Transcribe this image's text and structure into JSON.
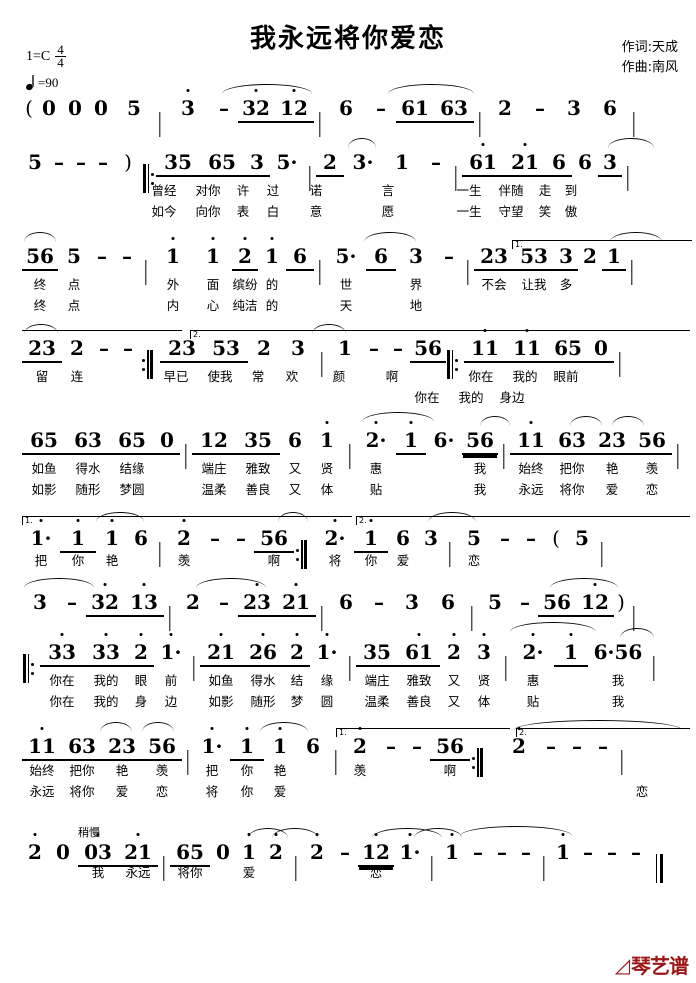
{
  "header": {
    "title": "我永远将你爱恋",
    "key_label": "1=C",
    "time_num": "4",
    "time_den": "4",
    "tempo": "=90",
    "lyricist": "作词:天成",
    "composer": "作曲:南风"
  },
  "markings": {
    "volta1": "1.",
    "volta2": "2.",
    "slow": "稍慢"
  },
  "logo": {
    "text": "琴艺谱",
    "color": "#9b1616"
  },
  "score": {
    "line1": {
      "notes": [
        "(",
        "0",
        "0",
        "0",
        "5",
        "|",
        "3",
        "–",
        "32",
        "12",
        "|",
        "6",
        "–",
        "61",
        "63",
        "|",
        "2",
        "–",
        "3",
        "6",
        "|"
      ]
    },
    "line2": {
      "notes": [
        "5",
        "–",
        "–",
        "–",
        ")",
        "‖:",
        "35",
        "65",
        "3",
        "5·",
        "|",
        "2",
        "3·",
        "1",
        "–",
        "|",
        "61",
        "21",
        "6",
        "6",
        "3",
        "|"
      ],
      "lyrics1": [
        "曾经",
        "对你",
        "许",
        "过",
        "诺",
        "言",
        "一生",
        "伴随",
        "走",
        "到"
      ],
      "lyrics2": [
        "如今",
        "向你",
        "表",
        "白",
        "意",
        "愿",
        "一生",
        "守望",
        "笑",
        "傲"
      ]
    },
    "line3": {
      "notes": [
        "56",
        "5",
        "–",
        "–",
        "|",
        "1",
        "1",
        "2",
        "1",
        "6",
        "|",
        "5·",
        "6",
        "3",
        "–",
        "|",
        "23",
        "53",
        "3",
        "2",
        "1",
        "|"
      ],
      "lyrics1": [
        "终",
        "点",
        "外",
        "面",
        "缤纷",
        "的",
        "世",
        "界",
        "不会",
        "让我",
        "多"
      ],
      "lyrics2": [
        "终",
        "点",
        "内",
        "心",
        "纯洁",
        "的",
        "天",
        "地"
      ]
    },
    "line4": {
      "notes": [
        "23",
        "2",
        "–",
        "–",
        ":‖",
        "23",
        "53",
        "2",
        "3",
        "|",
        "1",
        "–",
        "–",
        "56",
        "‖:",
        "11",
        "11",
        "65",
        "0",
        "|"
      ],
      "lyrics1": [
        "留",
        "连",
        "早已",
        "使我",
        "常",
        "欢",
        "颜",
        "啊",
        "你在",
        "我的",
        "眼前"
      ],
      "lyrics2": [
        "你在",
        "我的",
        "身边"
      ]
    },
    "line5": {
      "notes": [
        "65",
        "63",
        "65",
        "0",
        "|",
        "12",
        "35",
        "6",
        "1",
        "|",
        "2·",
        "1",
        "6·",
        "56",
        "|",
        "11",
        "63",
        "23",
        "56",
        "|"
      ],
      "lyrics1": [
        "如鱼",
        "得水",
        "结缘",
        "端庄",
        "雅致",
        "又",
        "贤",
        "惠",
        "我",
        "始终",
        "把你",
        "艳",
        "羡"
      ],
      "lyrics2": [
        "如影",
        "随形",
        "梦圆",
        "温柔",
        "善良",
        "又",
        "体",
        "贴",
        "我",
        "永远",
        "将你",
        "爱",
        "恋"
      ]
    },
    "line6": {
      "notes": [
        "1·",
        "1",
        "1",
        "6",
        "|",
        "2",
        "–",
        "–",
        "56",
        ":‖",
        "2·",
        "1",
        "6",
        "3",
        "|",
        "5",
        "–",
        "–",
        "(",
        "5",
        "|"
      ],
      "lyrics1": [
        "把",
        "你",
        "艳",
        "羡",
        "啊",
        "将",
        "你",
        "爱",
        "恋"
      ]
    },
    "line7": {
      "notes": [
        "3",
        "–",
        "32",
        "13",
        "|",
        "2",
        "–",
        "23",
        "21",
        "|",
        "6",
        "–",
        "3",
        "6",
        "|",
        "5",
        "–",
        "56",
        "12",
        ")",
        "|"
      ]
    },
    "line8": {
      "notes": [
        "‖:",
        "33",
        "33",
        "2",
        "1·",
        "|",
        "21",
        "26",
        "2",
        "1·",
        "|",
        "35",
        "61",
        "2",
        "3",
        "|",
        "2·",
        "1",
        "6·56",
        "|"
      ],
      "lyrics1": [
        "你在",
        "我的",
        "眼",
        "前",
        "如鱼",
        "得水",
        "结",
        "缘",
        "端庄",
        "雅致",
        "又",
        "贤",
        "惠",
        "我"
      ],
      "lyrics2": [
        "你在",
        "我的",
        "身",
        "边",
        "如影",
        "随形",
        "梦",
        "圆",
        "温柔",
        "善良",
        "又",
        "体",
        "贴",
        "我"
      ]
    },
    "line9": {
      "notes": [
        "11",
        "63",
        "23",
        "56",
        "|",
        "1·",
        "1",
        "1",
        "6",
        "|",
        "2",
        "–",
        "–",
        "56",
        ":‖",
        "2",
        "–",
        "–",
        "–",
        "|"
      ],
      "lyrics1": [
        "始终",
        "把你",
        "艳",
        "羡",
        "把",
        "你",
        "艳",
        "羡",
        "啊"
      ],
      "lyrics2": [
        "永远",
        "将你",
        "爱",
        "恋",
        "将",
        "你",
        "爱",
        "恋"
      ]
    },
    "line10": {
      "notes": [
        "2",
        "0",
        "03",
        "21",
        "|",
        "65",
        "0",
        "1",
        "2",
        "|",
        "2",
        "–",
        "12",
        "1·",
        "|",
        "1",
        "–",
        "–",
        "–",
        "|",
        "1",
        "–",
        "–",
        "–",
        "‖"
      ],
      "lyrics1": [
        "我",
        "永远",
        "将你",
        "爱",
        "恋"
      ]
    }
  }
}
